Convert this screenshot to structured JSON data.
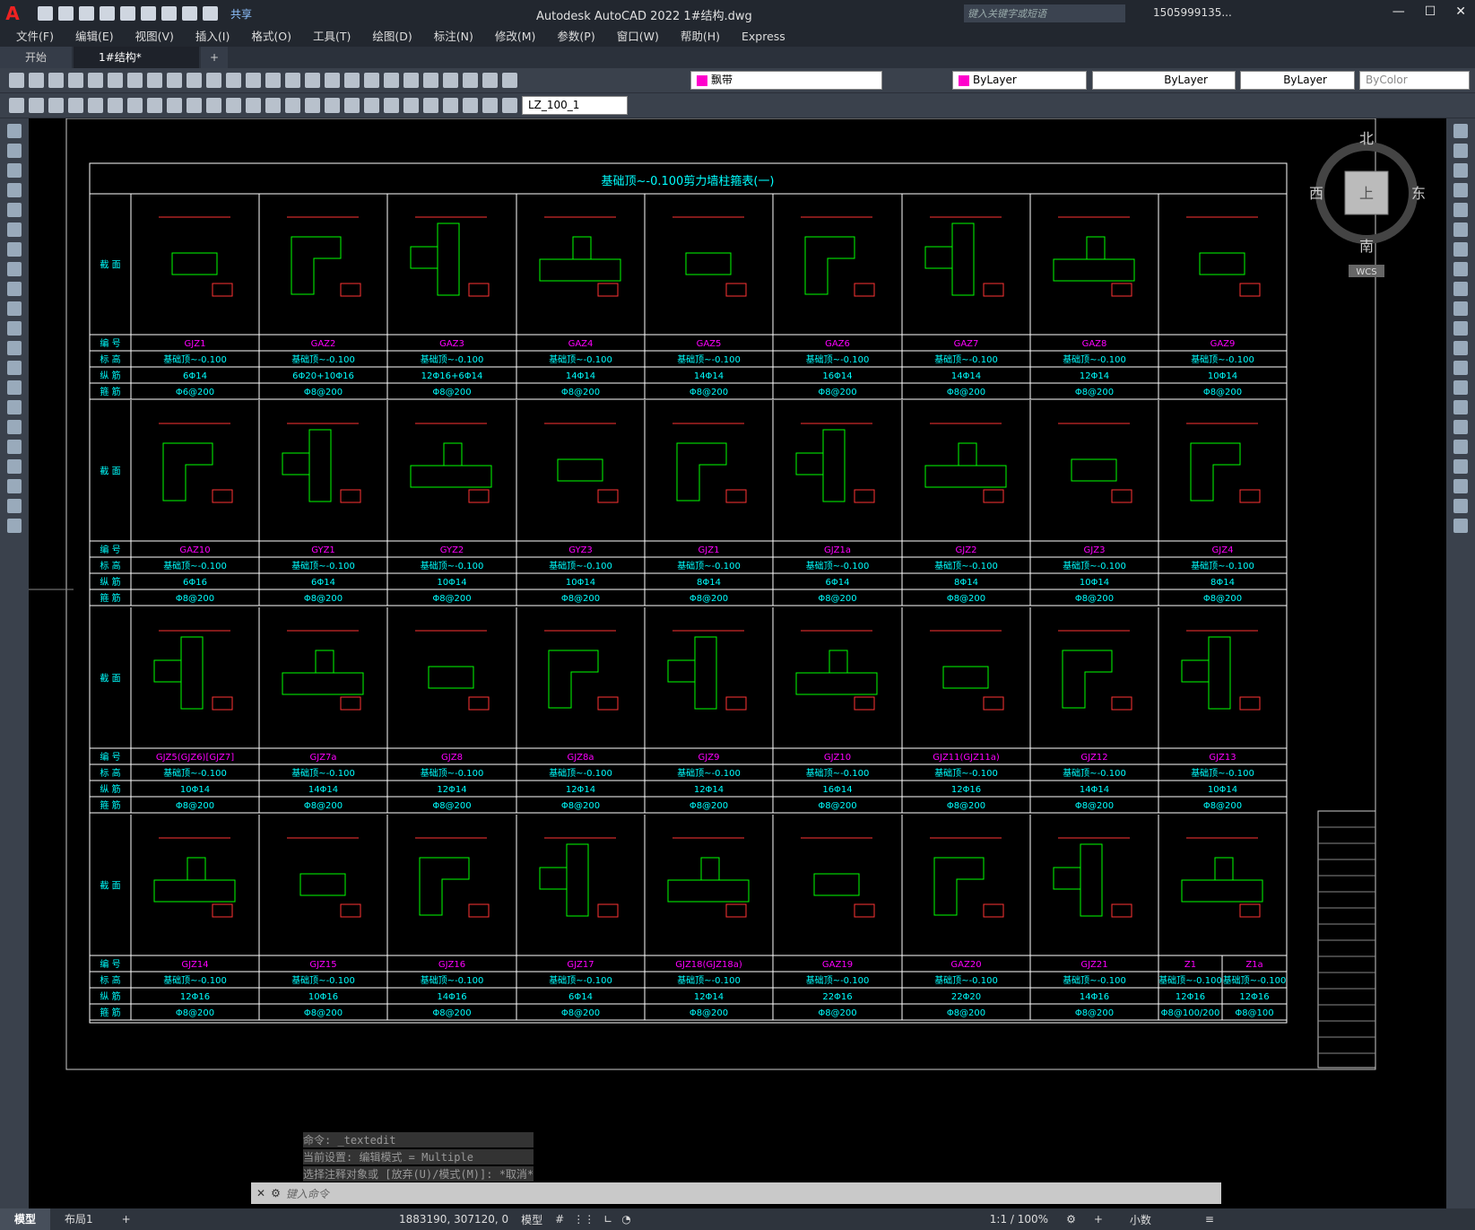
{
  "app": {
    "logo": "A",
    "title": "Autodesk AutoCAD 2022 1#结构.dwg",
    "share": "共享",
    "search_placeholder": "键入关键字或短语",
    "user": "1505999135...",
    "help": "?"
  },
  "menu": [
    "文件(F)",
    "编辑(E)",
    "视图(V)",
    "插入(I)",
    "格式(O)",
    "工具(T)",
    "绘图(D)",
    "标注(N)",
    "修改(M)",
    "参数(P)",
    "窗口(W)",
    "帮助(H)",
    "Express"
  ],
  "tabs": {
    "start": "开始",
    "doc": "1#结构*",
    "close": "✕",
    "add": "+"
  },
  "toolbar": {
    "layer": "飘带",
    "color": "ByLayer",
    "linetype": "ByLayer",
    "lineweight": "ByLayer",
    "plotstyle": "ByColor",
    "dimstyle": "LZ_100_1"
  },
  "viewcube": {
    "north": "北",
    "south": "南",
    "east": "东",
    "west": "西",
    "top": "上",
    "wcs": "WCS"
  },
  "table": {
    "title": "基础顶~-0.100剪力墙柱箍表(一)",
    "row_labels": {
      "section": "截 面",
      "id": "编 号",
      "elev": "标 高",
      "long": "纵 筋",
      "stirrup": "箍 筋"
    },
    "blocks": [
      {
        "ids": [
          "GJZ1",
          "GAZ2",
          "GAZ3",
          "GAZ4",
          "GAZ5",
          "GAZ6",
          "GAZ7",
          "GAZ8",
          "GAZ9"
        ],
        "elev": [
          "基础顶~-0.100",
          "基础顶~-0.100",
          "基础顶~-0.100",
          "基础顶~-0.100",
          "基础顶~-0.100",
          "基础顶~-0.100",
          "基础顶~-0.100",
          "基础顶~-0.100",
          "基础顶~-0.100"
        ],
        "long": [
          "6Φ14",
          "6Φ20+10Φ16",
          "12Φ16+6Φ14",
          "14Φ14",
          "14Φ14",
          "16Φ14",
          "14Φ14",
          "12Φ14",
          "10Φ14"
        ],
        "stir": [
          "Φ6@200",
          "Φ8@200",
          "Φ8@200",
          "Φ8@200",
          "Φ8@200",
          "Φ8@200",
          "Φ8@200",
          "Φ8@200",
          "Φ8@200"
        ]
      },
      {
        "ids": [
          "GAZ10",
          "GYZ1",
          "GYZ2",
          "GYZ3",
          "GJZ1",
          "GJZ1a",
          "GJZ2",
          "GJZ3",
          "GJZ4"
        ],
        "elev": [
          "基础顶~-0.100",
          "基础顶~-0.100",
          "基础顶~-0.100",
          "基础顶~-0.100",
          "基础顶~-0.100",
          "基础顶~-0.100",
          "基础顶~-0.100",
          "基础顶~-0.100",
          "基础顶~-0.100"
        ],
        "long": [
          "6Φ16",
          "6Φ14",
          "10Φ14",
          "10Φ14",
          "8Φ14",
          "6Φ14",
          "8Φ14",
          "10Φ14",
          "8Φ14"
        ],
        "stir": [
          "Φ8@200",
          "Φ8@200",
          "Φ8@200",
          "Φ8@200",
          "Φ8@200",
          "Φ8@200",
          "Φ8@200",
          "Φ8@200",
          "Φ8@200"
        ]
      },
      {
        "ids": [
          "GJZ5(GJZ6)[GJZ7]",
          "GJZ7a",
          "GJZ8",
          "GJZ8a",
          "GJZ9",
          "GJZ10",
          "GJZ11(GJZ11a)",
          "GJZ12",
          "GJZ13"
        ],
        "elev": [
          "基础顶~-0.100",
          "基础顶~-0.100",
          "基础顶~-0.100",
          "基础顶~-0.100",
          "基础顶~-0.100",
          "基础顶~-0.100",
          "基础顶~-0.100",
          "基础顶~-0.100",
          "基础顶~-0.100"
        ],
        "long": [
          "10Φ14",
          "14Φ14",
          "12Φ14",
          "12Φ14",
          "12Φ14",
          "16Φ14",
          "12Φ16",
          "14Φ14",
          "10Φ14"
        ],
        "stir": [
          "Φ8@200",
          "Φ8@200",
          "Φ8@200",
          "Φ8@200",
          "Φ8@200",
          "Φ8@200",
          "Φ8@200",
          "Φ8@200",
          "Φ8@200"
        ]
      },
      {
        "ids": [
          "GJZ14",
          "GJZ15",
          "GJZ16",
          "GJZ17",
          "GJZ18(GJZ18a)",
          "GAZ19",
          "GAZ20",
          "GJZ21",
          "Z1",
          "Z1a"
        ],
        "elev": [
          "基础顶~-0.100",
          "基础顶~-0.100",
          "基础顶~-0.100",
          "基础顶~-0.100",
          "基础顶~-0.100",
          "基础顶~-0.100",
          "基础顶~-0.100",
          "基础顶~-0.100",
          "基础顶~-0.100",
          "基础顶~-0.100"
        ],
        "long": [
          "12Φ16",
          "10Φ16",
          "14Φ16",
          "6Φ14",
          "12Φ14",
          "22Φ16",
          "22Φ20",
          "14Φ16",
          "12Φ16",
          "12Φ16"
        ],
        "stir": [
          "Φ8@200",
          "Φ8@200",
          "Φ8@200",
          "Φ8@200",
          "Φ8@200",
          "Φ8@200",
          "Φ8@200",
          "Φ8@200",
          "Φ8@100/200",
          "Φ8@100"
        ]
      }
    ]
  },
  "command": {
    "history": [
      "命令: _textedit",
      "当前设置: 编辑模式 = Multiple",
      "选择注释对象或 [放弃(U)/模式(M)]: *取消*"
    ],
    "placeholder": "键入命令"
  },
  "layouts": [
    "模型",
    "布局1",
    "+"
  ],
  "status": {
    "coords": "1883190, 307120, 0",
    "model": "模型",
    "scale": "1:1 / 100%",
    "units": "小数"
  },
  "colors": {
    "frame": "#ffffff",
    "title": "#00ffff",
    "id": "#ff00ff",
    "wall": "#00ff00",
    "rebar": "#ff3333",
    "dim": "#dddddd"
  }
}
